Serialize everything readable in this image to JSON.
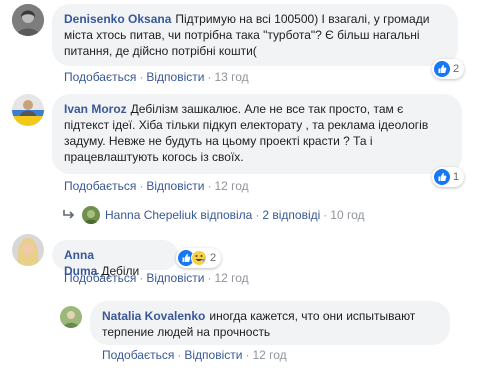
{
  "ui": {
    "like_action": "Подобається",
    "reply_action": "Відповісти",
    "separator": "·"
  },
  "comments": [
    {
      "author": "Denisenko Oksana",
      "text": "Підтримую на всі 100500) І взагалі, у громади міста хтось питав, чи потрібна така \"турбота\"? Є більш нагальні питання, де дійсно потрібні кошти(",
      "time": "13 год",
      "reaction_count": "2",
      "reactions": [
        "like-icon"
      ]
    },
    {
      "author": "Ivan Moroz",
      "text": "Дебілізм зашкалює. Але не все так просто, там є підтекст ідеї. Хіба тільки підкуп електорату , та реклама ідеологів задуму. Невже не будуть на цьому проекті красти ? Та і працевлаштують когось із своїх.",
      "time": "12 год",
      "reaction_count": "1",
      "reactions": [
        "like-icon"
      ],
      "replies_summary": {
        "name": "Hanna Chepeliuk",
        "action": "відповіла",
        "count": "2 відповіді",
        "time": "10 год"
      }
    },
    {
      "author": "Anna Duma",
      "text": "Дебіли",
      "time": "12 год",
      "reaction_count": "2",
      "reactions": [
        "like-icon",
        "haha-icon"
      ],
      "replies": [
        {
          "author": "Natalia Kovalenko",
          "text": "иногда кажется, что они испытывают терпение людей на прочность",
          "time": "12 год"
        }
      ]
    }
  ],
  "colors": {
    "link": "#385898",
    "bubble": "#f2f3f5",
    "meta": "#90949c",
    "like": "#1877f2"
  }
}
